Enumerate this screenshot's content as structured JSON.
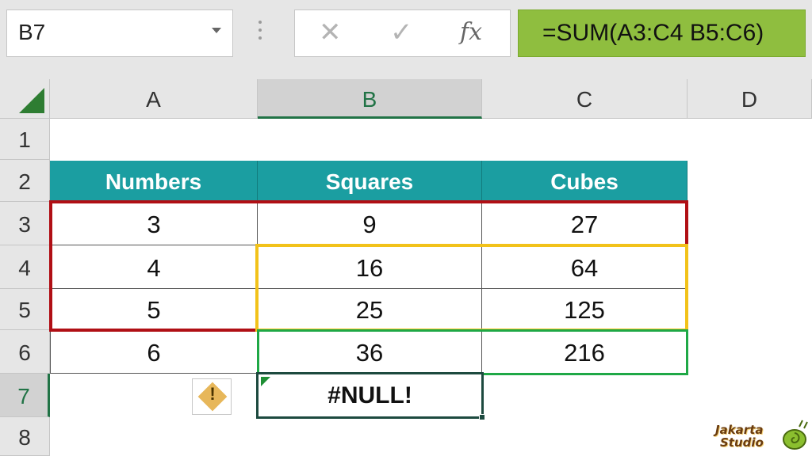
{
  "formula_bar": {
    "name_box": "B7",
    "cancel_icon": "close-icon",
    "enter_icon": "check-icon",
    "fx_label": "fx",
    "formula": "=SUM(A3:C4 B5:C6)",
    "formula_bg": "#8fbe3f"
  },
  "grid": {
    "columns": [
      "A",
      "B",
      "C",
      "D"
    ],
    "rows": [
      "1",
      "2",
      "3",
      "4",
      "5",
      "6",
      "7",
      "8"
    ],
    "selected_column": "B",
    "selected_row": "7",
    "header_row": [
      "Numbers",
      "Squares",
      "Cubes"
    ],
    "header_color": "#1b9ea1",
    "data_rows": [
      [
        "3",
        "9",
        "27"
      ],
      [
        "4",
        "16",
        "64"
      ],
      [
        "5",
        "25",
        "125"
      ],
      [
        "6",
        "36",
        "216"
      ]
    ],
    "active_cell": {
      "ref": "B7",
      "value": "#NULL!"
    },
    "error_icon": "warning-diamond-icon",
    "error_icon_glyph": "!",
    "range_colors": {
      "A3:C5": "#b00f15",
      "B4:C5": "#f2c21a",
      "B5:C6": "#1fa846"
    }
  },
  "watermark": {
    "line1": "Jakarta",
    "line2": "Studio"
  }
}
